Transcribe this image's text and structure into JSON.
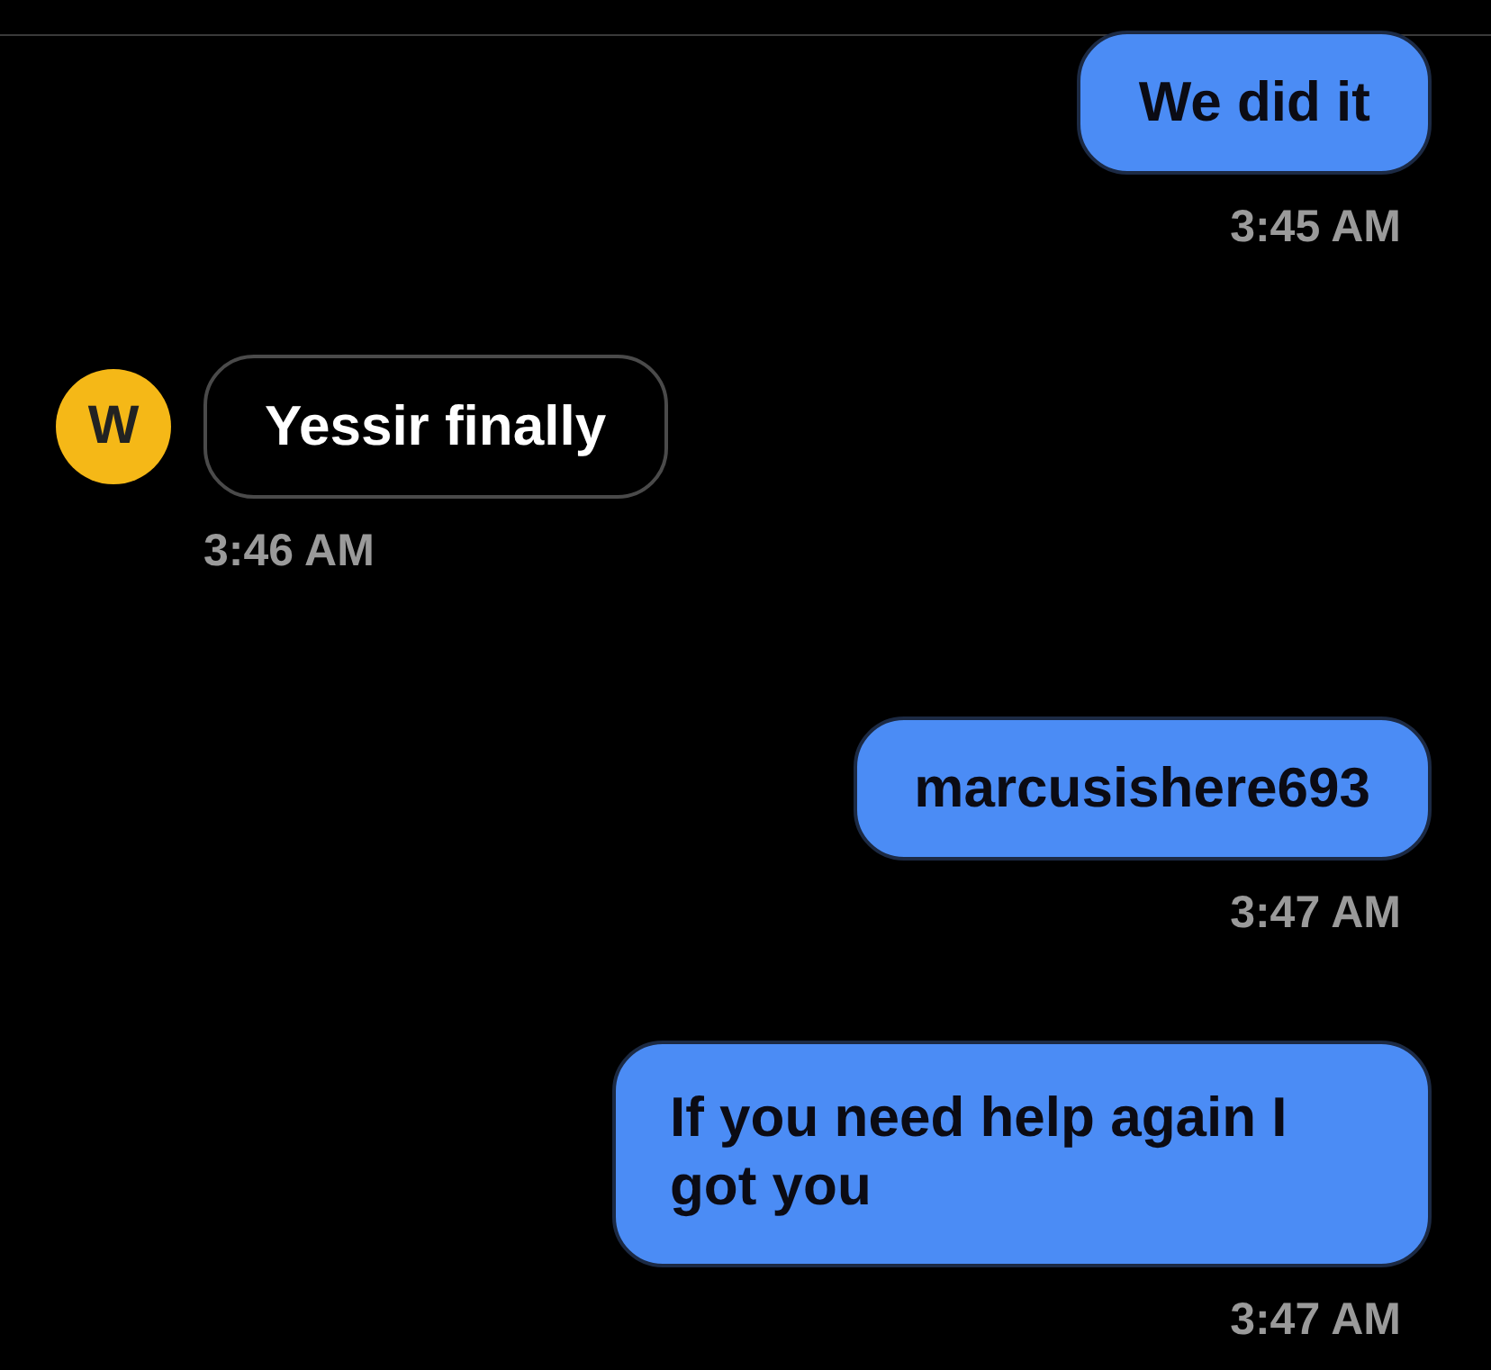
{
  "messages": [
    {
      "kind": "sent",
      "text": "We did it",
      "time": "3:45 AM"
    },
    {
      "kind": "received",
      "avatar": "W",
      "text": "Yessir finally",
      "time": "3:46 AM"
    },
    {
      "kind": "sent",
      "text": "marcusishere693",
      "time": "3:47 AM"
    },
    {
      "kind": "sent",
      "text": "If you need help again I got you",
      "time": "3:47 AM"
    }
  ]
}
